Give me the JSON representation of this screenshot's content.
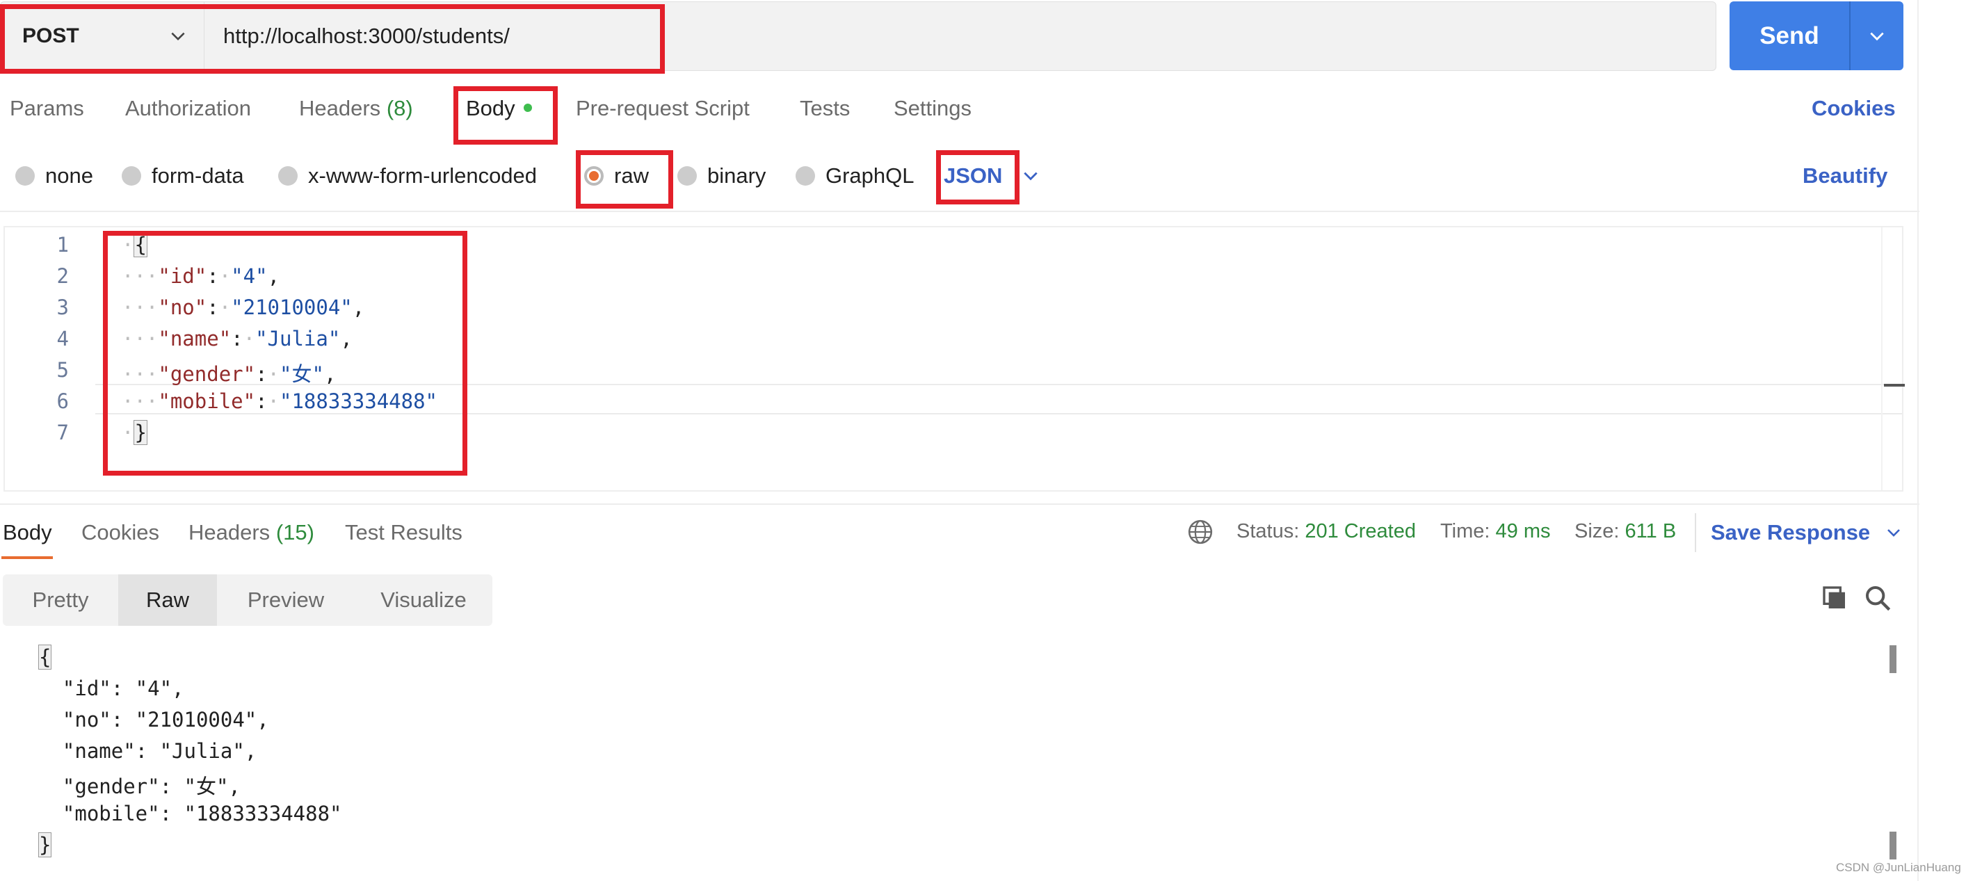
{
  "request": {
    "method": "POST",
    "url": "http://localhost:3000/students/",
    "send_label": "Send"
  },
  "request_tabs": {
    "params": "Params",
    "authorization": "Authorization",
    "headers": "Headers",
    "headers_count": "(8)",
    "body": "Body",
    "pre_request": "Pre-request Script",
    "tests": "Tests",
    "settings": "Settings",
    "cookies": "Cookies"
  },
  "body_types": {
    "none": "none",
    "form_data": "form-data",
    "urlencoded": "x-www-form-urlencoded",
    "raw": "raw",
    "binary": "binary",
    "graphql": "GraphQL",
    "selected": "raw",
    "language": "JSON",
    "beautify": "Beautify"
  },
  "editor": {
    "line_numbers": [
      "1",
      "2",
      "3",
      "4",
      "5",
      "6",
      "7"
    ],
    "open_brace": "{",
    "close_brace": "}",
    "fields": [
      {
        "key": "\"id\"",
        "value": "\"4\"",
        "comma": ","
      },
      {
        "key": "\"no\"",
        "value": "\"21010004\"",
        "comma": ","
      },
      {
        "key": "\"name\"",
        "value": "\"Julia\"",
        "comma": ","
      },
      {
        "key": "\"gender\"",
        "value": "\"女\"",
        "comma": ","
      },
      {
        "key": "\"mobile\"",
        "value": "\"18833334488\"",
        "comma": ""
      }
    ]
  },
  "response": {
    "tabs": {
      "body": "Body",
      "cookies": "Cookies",
      "headers": "Headers",
      "headers_count": "(15)",
      "test_results": "Test Results"
    },
    "status_label": "Status:",
    "status_value": "201 Created",
    "time_label": "Time:",
    "time_value": "49 ms",
    "size_label": "Size:",
    "size_value": "611 B",
    "save_label": "Save Response",
    "view_modes": {
      "pretty": "Pretty",
      "raw": "Raw",
      "preview": "Preview",
      "visualize": "Visualize",
      "active": "Raw"
    },
    "body_lines": [
      "{",
      "  \"id\": \"4\",",
      "  \"no\": \"21010004\",",
      "  \"name\": \"Julia\",",
      "  \"gender\": \"女\",",
      "  \"mobile\": \"18833334488\"",
      "}"
    ]
  },
  "watermark": "CSDN @JunLianHuang",
  "colors": {
    "accent_blue": "#3f7fe6",
    "link_blue": "#3a62c5",
    "highlight_red": "#e3202a",
    "success_green": "#2e8b3c",
    "radio_orange": "#e86c30",
    "json_key": "#922b2b",
    "json_string": "#1e4fa3"
  }
}
